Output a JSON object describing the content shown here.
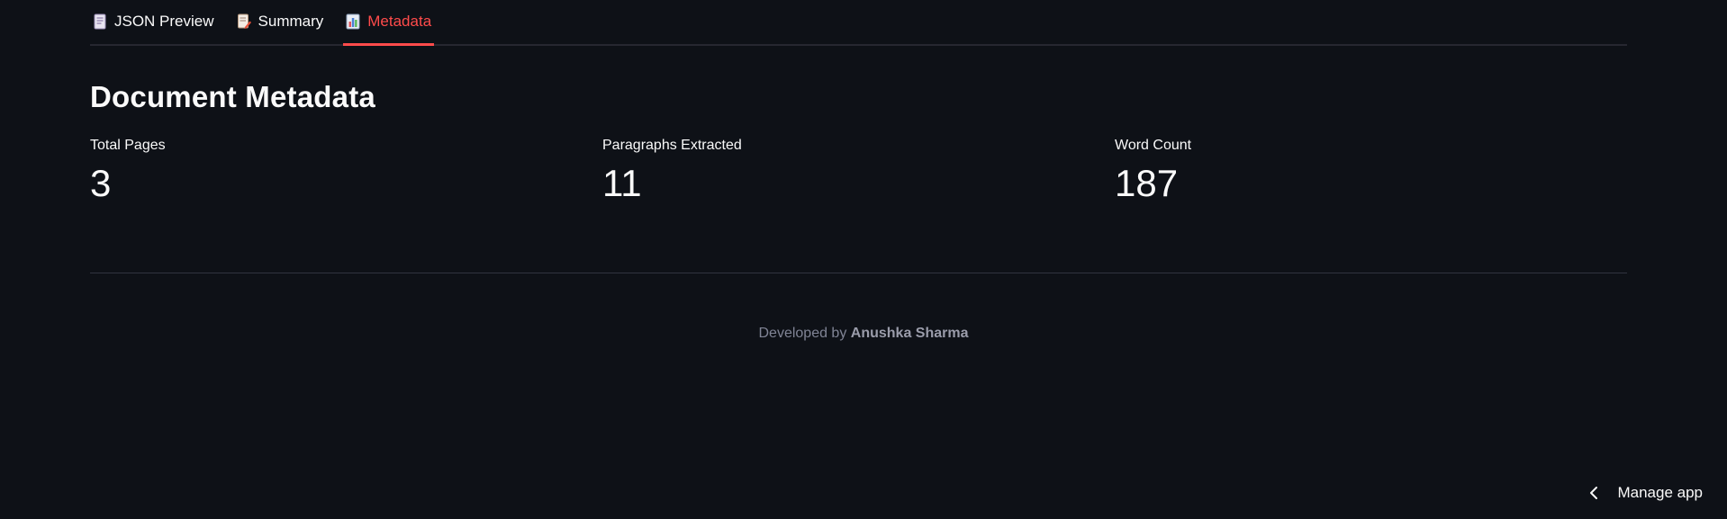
{
  "tabs": [
    {
      "label": "JSON Preview",
      "icon": "document-icon",
      "active": false
    },
    {
      "label": "Summary",
      "icon": "document-pencil-icon",
      "active": false
    },
    {
      "label": "Metadata",
      "icon": "bar-chart-icon",
      "active": true
    }
  ],
  "main": {
    "heading": "Document Metadata",
    "metrics": [
      {
        "label": "Total Pages",
        "value": "3"
      },
      {
        "label": "Paragraphs Extracted",
        "value": "11"
      },
      {
        "label": "Word Count",
        "value": "187"
      }
    ]
  },
  "footer": {
    "prefix": "Developed by ",
    "author": "Anushka Sharma"
  },
  "manage_app": {
    "label": "Manage app",
    "icon": "chevron-left-icon"
  },
  "colors": {
    "background": "#0e1117",
    "accent": "#ff4b4b",
    "text": "#fafafa",
    "muted": "#808495"
  }
}
